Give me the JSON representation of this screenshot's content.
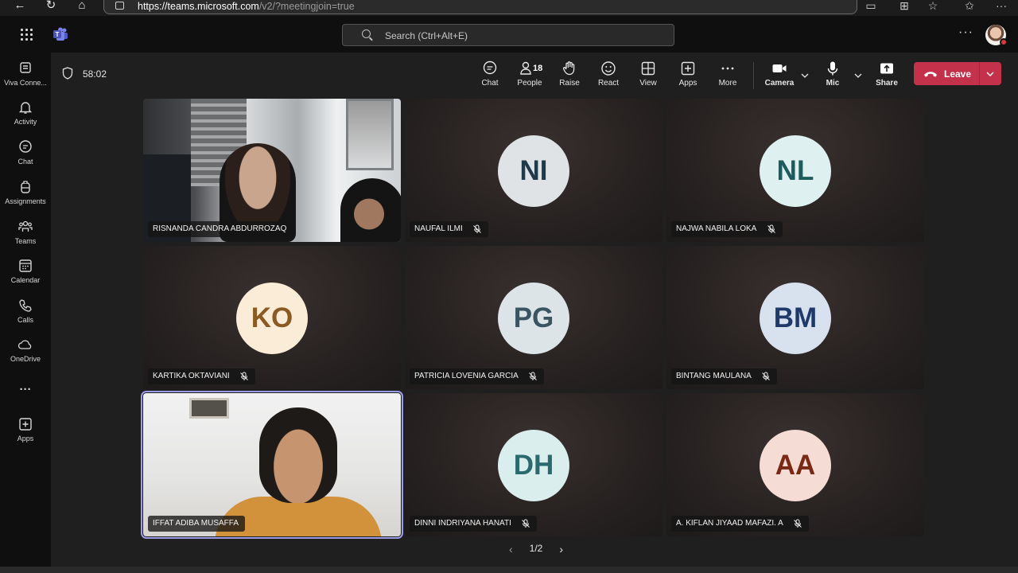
{
  "browser": {
    "url_host": "https://teams.microsoft.com",
    "url_path": "/v2/?meetingjoin=true"
  },
  "header": {
    "search_placeholder": "Search (Ctrl+Alt+E)",
    "more": "···"
  },
  "rail": {
    "items": [
      {
        "label": "Viva Conne...",
        "icon": "viva-connections-icon"
      },
      {
        "label": "Activity",
        "icon": "bell-icon"
      },
      {
        "label": "Chat",
        "icon": "chat-icon"
      },
      {
        "label": "Assignments",
        "icon": "backpack-icon"
      },
      {
        "label": "Teams",
        "icon": "teams-icon"
      },
      {
        "label": "Calendar",
        "icon": "calendar-icon"
      },
      {
        "label": "Calls",
        "icon": "phone-icon"
      },
      {
        "label": "OneDrive",
        "icon": "cloud-icon"
      },
      {
        "label": "···",
        "icon": "more-icon"
      },
      {
        "label": "Apps",
        "icon": "apps-icon"
      }
    ]
  },
  "meeting": {
    "timer": "58:02",
    "toolbar": {
      "chat": "Chat",
      "people": "People",
      "people_count": "18",
      "raise": "Raise",
      "react": "React",
      "view": "View",
      "apps": "Apps",
      "more": "More",
      "camera": "Camera",
      "mic": "Mic",
      "share": "Share",
      "leave": "Leave"
    },
    "participants": [
      {
        "name": "RISNANDA CANDRA ABDURROZAQ",
        "initials": "",
        "video": true,
        "muted": false
      },
      {
        "name": "NAUFAL ILMI",
        "initials": "NI",
        "video": false,
        "muted": true,
        "bg": "#dfe3e6",
        "fg": "#1f3a4a"
      },
      {
        "name": "NAJWA NABILA LOKA",
        "initials": "NL",
        "video": false,
        "muted": true,
        "bg": "#dff0f0",
        "fg": "#1e5b5e"
      },
      {
        "name": "KARTIKA OKTAVIANI",
        "initials": "KO",
        "video": false,
        "muted": true,
        "bg": "#fbecd8",
        "fg": "#8a5a22"
      },
      {
        "name": "PATRICIA LOVENIA GARCIA",
        "initials": "PG",
        "video": false,
        "muted": true,
        "bg": "#dce4e8",
        "fg": "#3b5462"
      },
      {
        "name": "BINTANG MAULANA",
        "initials": "BM",
        "video": false,
        "muted": true,
        "bg": "#d8e1ee",
        "fg": "#1f3a6a"
      },
      {
        "name": "IFFAT ADIBA MUSAFFA",
        "initials": "",
        "video": true,
        "muted": false
      },
      {
        "name": "DINNI INDRIYANA HANATI",
        "initials": "DH",
        "video": false,
        "muted": true,
        "bg": "#dbeeee",
        "fg": "#2a6a6e"
      },
      {
        "name": "A. KIFLAN JIYAAD MAFAZI. A",
        "initials": "AA",
        "video": false,
        "muted": true,
        "bg": "#f5dcd4",
        "fg": "#7a2a14"
      }
    ],
    "pager": "1/2"
  }
}
